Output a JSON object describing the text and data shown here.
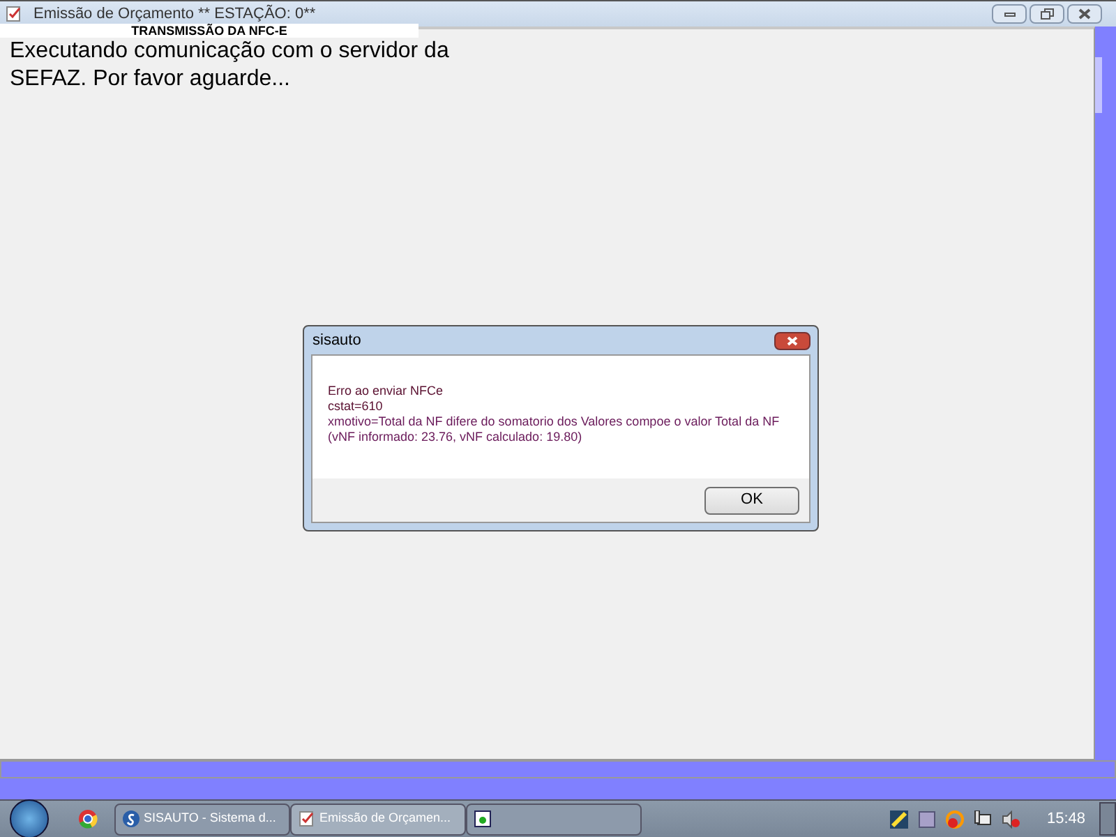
{
  "window": {
    "title": "Emissão de Orçamento  ** ESTAÇÃO: 0**"
  },
  "panel": {
    "header": "TRANSMISSÃO DA NFC-E",
    "message": "Executando comunicação com o servidor da SEFAZ. Por favor aguarde..."
  },
  "dialog": {
    "title": "sisauto",
    "lines": [
      "Erro ao enviar NFCe",
      "cstat=610",
      "xmotivo=Total da NF difere do somatorio dos Valores compoe o valor Total da NF (vNF informado: 23.76, vNF calculado: 19.80)"
    ],
    "button": "OK"
  },
  "taskbar": {
    "tasks": [
      {
        "kind": "app",
        "label": "SISAUTO - Sistema d...",
        "selected": false
      },
      {
        "kind": "doc",
        "label": "Emissão de Orçamen...",
        "selected": true
      },
      {
        "kind": "grid",
        "selected": false
      }
    ],
    "clock": "15:48"
  }
}
